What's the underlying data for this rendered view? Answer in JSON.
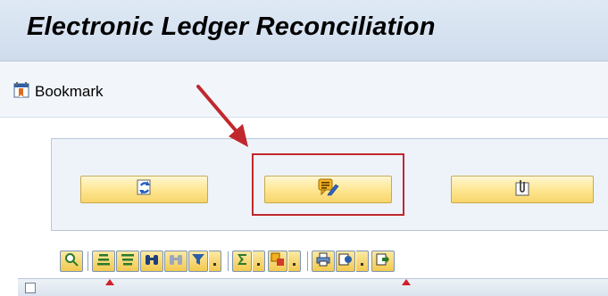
{
  "window": {
    "title": "Electronic Ledger Reconciliation"
  },
  "app_toolbar": {
    "bookmark_label": "Bookmark",
    "bookmark_icon": "bookmark-icon"
  },
  "buttons": {
    "refresh": {
      "icon": "refresh-icon"
    },
    "edit": {
      "icon": "edit-note-icon"
    },
    "attach": {
      "icon": "attachment-icon"
    }
  },
  "annotation": {
    "highlight_color": "#c0282e",
    "arrow_color": "#c0282e"
  },
  "alv_toolbar": {
    "icons": [
      "details-icon",
      "sort-ascending-icon",
      "sort-descending-icon",
      "find-icon",
      "find-next-icon",
      "filter-icon",
      "sum-icon",
      "subtotal-icon",
      "print-icon",
      "views-icon",
      "export-icon"
    ]
  }
}
